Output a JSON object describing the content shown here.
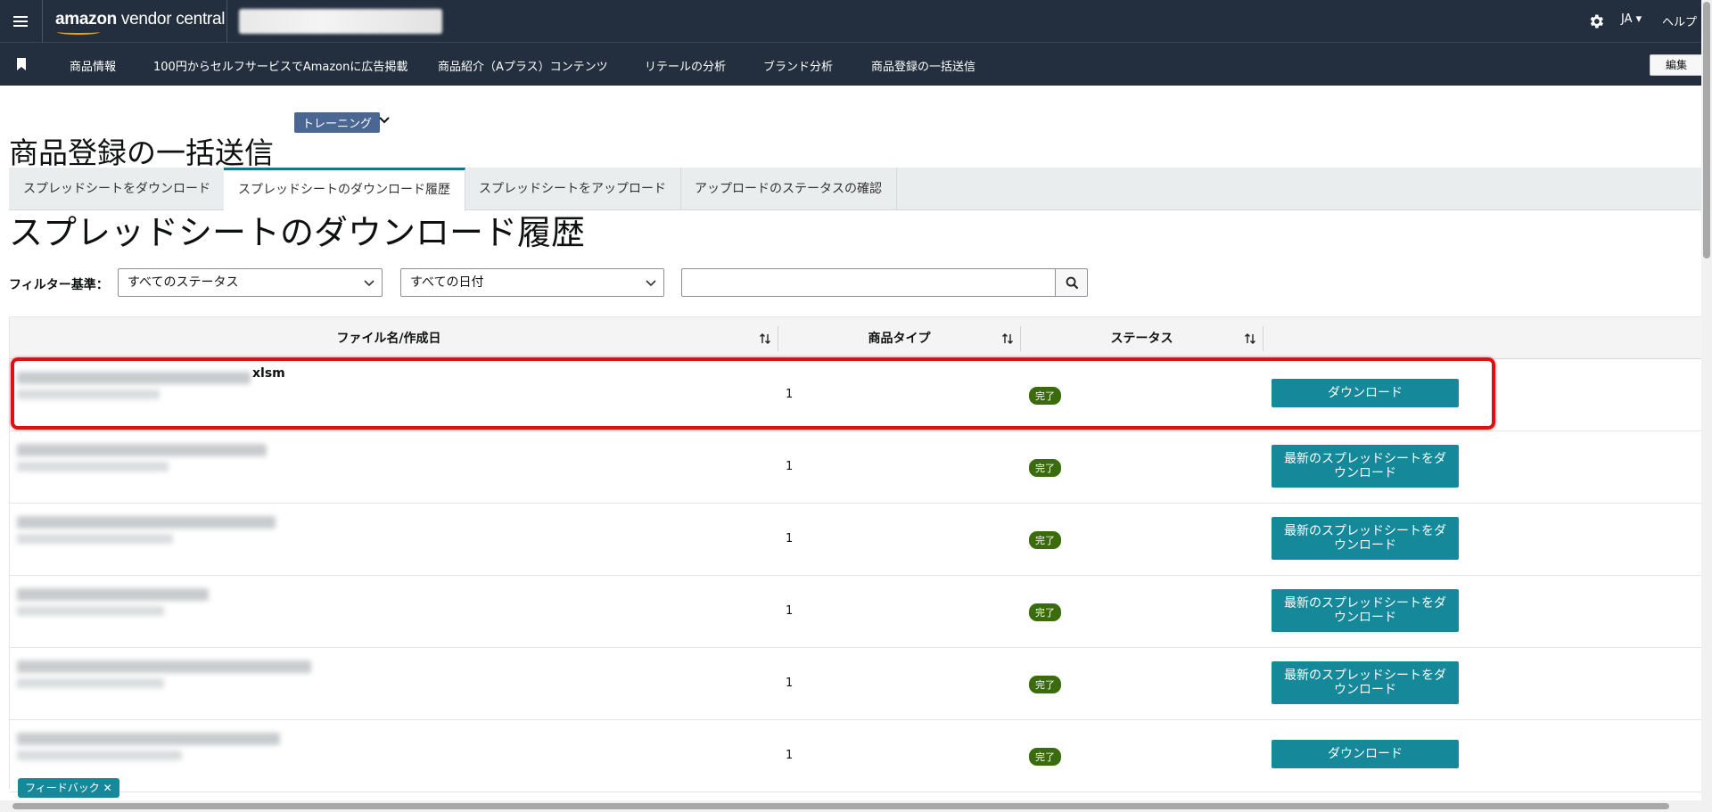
{
  "topbar": {
    "logo_bold": "amazon",
    "logo_rest": " vendor central",
    "lang": "JA",
    "help": "ヘルプ"
  },
  "nav": {
    "items": [
      "商品情報",
      "100円からセルフサービスでAmazonに広告掲載",
      "商品紹介（Aプラス）コンテンツ",
      "リテールの分析",
      "ブランド分析",
      "商品登録の一括送信"
    ],
    "edit": "編集"
  },
  "page": {
    "title": "商品登録の一括送信",
    "training_badge": "トレーニング"
  },
  "tabs": [
    {
      "label": "スプレッドシートをダウンロード",
      "active": false
    },
    {
      "label": "スプレッドシートのダウンロード履歴",
      "active": true
    },
    {
      "label": "スプレッドシートをアップロード",
      "active": false
    },
    {
      "label": "アップロードのステータスの確認",
      "active": false
    }
  ],
  "section": {
    "title": "スプレッドシートのダウンロード履歴"
  },
  "filters": {
    "label": "フィルター基準：",
    "status_value": "すべてのステータス",
    "date_value": "すべての日付",
    "search_value": ""
  },
  "table": {
    "headers": [
      "ファイル名/作成日",
      "商品タイプ",
      "ステータス"
    ],
    "rows": [
      {
        "name_visible": "xlsm",
        "type": "1",
        "status": "完了",
        "action": "ダウンロード"
      },
      {
        "name_visible": "",
        "type": "1",
        "status": "完了",
        "action": "最新のスプレッドシートをダウンロード"
      },
      {
        "name_visible": "",
        "type": "1",
        "status": "完了",
        "action": "最新のスプレッドシートをダウンロード"
      },
      {
        "name_visible": "",
        "type": "1",
        "status": "完了",
        "action": "最新のスプレッドシートをダウンロード"
      },
      {
        "name_visible": "",
        "type": "1",
        "status": "完了",
        "action": "最新のスプレッドシートをダウンロード"
      },
      {
        "name_visible": "",
        "type": "1",
        "status": "完了",
        "action": "ダウンロード"
      }
    ]
  },
  "feedback": {
    "label": "フィードバック ✕"
  },
  "colors": {
    "header_bg": "#232f3e",
    "accent_teal": "#15889a",
    "status_green": "#3a6b0c",
    "highlight_red": "#e01010"
  }
}
